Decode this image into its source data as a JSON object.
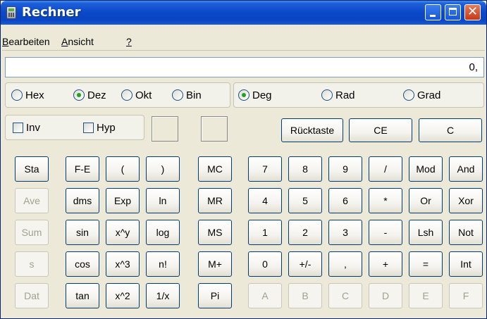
{
  "window": {
    "title": "Rechner"
  },
  "menu": {
    "items": [
      {
        "underline": "B",
        "rest": "earbeiten"
      },
      {
        "underline": "A",
        "rest": "nsicht"
      },
      {
        "underline": "?",
        "rest": ""
      }
    ]
  },
  "display": {
    "value": "0,"
  },
  "base": {
    "options": [
      "Hex",
      "Dez",
      "Okt",
      "Bin"
    ],
    "selected": "Dez"
  },
  "angle": {
    "options": [
      "Deg",
      "Rad",
      "Grad"
    ],
    "selected": "Deg"
  },
  "checks": {
    "inv": "Inv",
    "hyp": "Hyp"
  },
  "controls": {
    "backspace": "Rücktaste",
    "ce": "CE",
    "c": "C"
  },
  "stat": [
    "Sta",
    "Ave",
    "Sum",
    "s",
    "Dat"
  ],
  "sci": [
    [
      "F-E",
      "(",
      ")"
    ],
    [
      "dms",
      "Exp",
      "ln"
    ],
    [
      "sin",
      "x^y",
      "log"
    ],
    [
      "cos",
      "x^3",
      "n!"
    ],
    [
      "tan",
      "x^2",
      "1/x"
    ]
  ],
  "memory": [
    "MC",
    "MR",
    "MS",
    "M+",
    "Pi"
  ],
  "numpad": [
    [
      "7",
      "8",
      "9",
      "/",
      "Mod",
      "And"
    ],
    [
      "4",
      "5",
      "6",
      "*",
      "Or",
      "Xor"
    ],
    [
      "1",
      "2",
      "3",
      "-",
      "Lsh",
      "Not"
    ],
    [
      "0",
      "+/-",
      ",",
      "+",
      "=",
      "Int"
    ],
    [
      "A",
      "B",
      "C",
      "D",
      "E",
      "F"
    ]
  ]
}
